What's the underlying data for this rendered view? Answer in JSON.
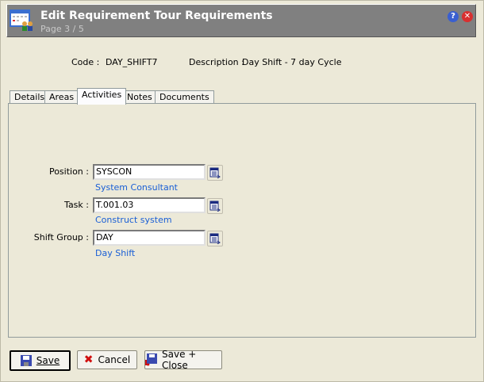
{
  "header": {
    "title": "Edit Requirement Tour Requirements",
    "subtitle": "Page 3 / 5",
    "help": "?",
    "close": "✕"
  },
  "record": {
    "code_label": "Code :",
    "code": "DAY_SHIFT7",
    "description_label": "Description :",
    "description": "Day Shift - 7 day Cycle"
  },
  "tabs": [
    {
      "label": "Details"
    },
    {
      "label": "Areas"
    },
    {
      "label": "Activities",
      "active": true
    },
    {
      "label": "Notes"
    },
    {
      "label": "Documents"
    }
  ],
  "fields": {
    "position": {
      "label": "Position :",
      "value": "SYSCON",
      "link": "System Consultant"
    },
    "task": {
      "label": "Task :",
      "value": "T.001.03",
      "link": "Construct system"
    },
    "shift_group": {
      "label": "Shift Group :",
      "value": "DAY",
      "link": "Day Shift"
    }
  },
  "buttons": {
    "save": "Save",
    "cancel": "Cancel",
    "save_close": "Save + Close"
  },
  "colors": {
    "link": "#1a5fd6",
    "header": "#808080"
  }
}
